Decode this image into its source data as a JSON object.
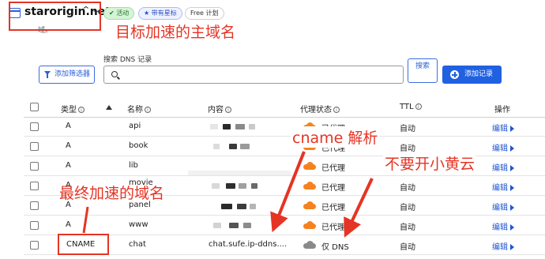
{
  "header": {
    "domain": "starorigin.net",
    "chevron": "⌃⌄",
    "badges": [
      "✔ 活动",
      "★ 带有星标",
      "Free 计划"
    ],
    "partial_text": "域。"
  },
  "annotations": {
    "main_domain": "目标加速的主域名",
    "cname_resolve": "cname 解析",
    "final_domain": "最终加速的域名",
    "no_proxy": "不要开小黄云"
  },
  "toolbar": {
    "filter_label": "添加筛选器",
    "search_label": "搜索 DNS 记录",
    "search_value": "",
    "search_button": "搜索",
    "add_record": "添加记录"
  },
  "table": {
    "headers": {
      "type": "类型",
      "name": "名称",
      "content": "内容",
      "proxy": "代理状态",
      "ttl": "TTL",
      "actions": "操作"
    },
    "rows": [
      {
        "type": "A",
        "name": "api",
        "content": "",
        "proxy": "已代理",
        "proxied": true,
        "ttl": "自动",
        "action": "编辑"
      },
      {
        "type": "A",
        "name": "book",
        "content": "",
        "proxy": "已代理",
        "proxied": true,
        "ttl": "自动",
        "action": "编辑"
      },
      {
        "type": "A",
        "name": "lib",
        "content": "",
        "proxy": "已代理",
        "proxied": true,
        "ttl": "自动",
        "action": "编辑"
      },
      {
        "type": "A",
        "name": "movie",
        "content": "",
        "proxy": "已代理",
        "proxied": true,
        "ttl": "自动",
        "action": "编辑"
      },
      {
        "type": "A",
        "name": "panel",
        "content": "",
        "proxy": "已代理",
        "proxied": true,
        "ttl": "自动",
        "action": "编辑"
      },
      {
        "type": "A",
        "name": "www",
        "content": "",
        "proxy": "已代理",
        "proxied": true,
        "ttl": "自动",
        "action": "编辑"
      },
      {
        "type": "CNAME",
        "name": "chat",
        "content": "chat.sufe.ip-ddns....",
        "proxy": "仅 DNS",
        "proxied": false,
        "ttl": "自动",
        "action": "编辑"
      }
    ]
  },
  "colors": {
    "accent": "#1f61e0",
    "annotation": "#e53424",
    "proxied_cloud": "#f6821f",
    "dns_only_cloud": "#8a8a8a"
  }
}
